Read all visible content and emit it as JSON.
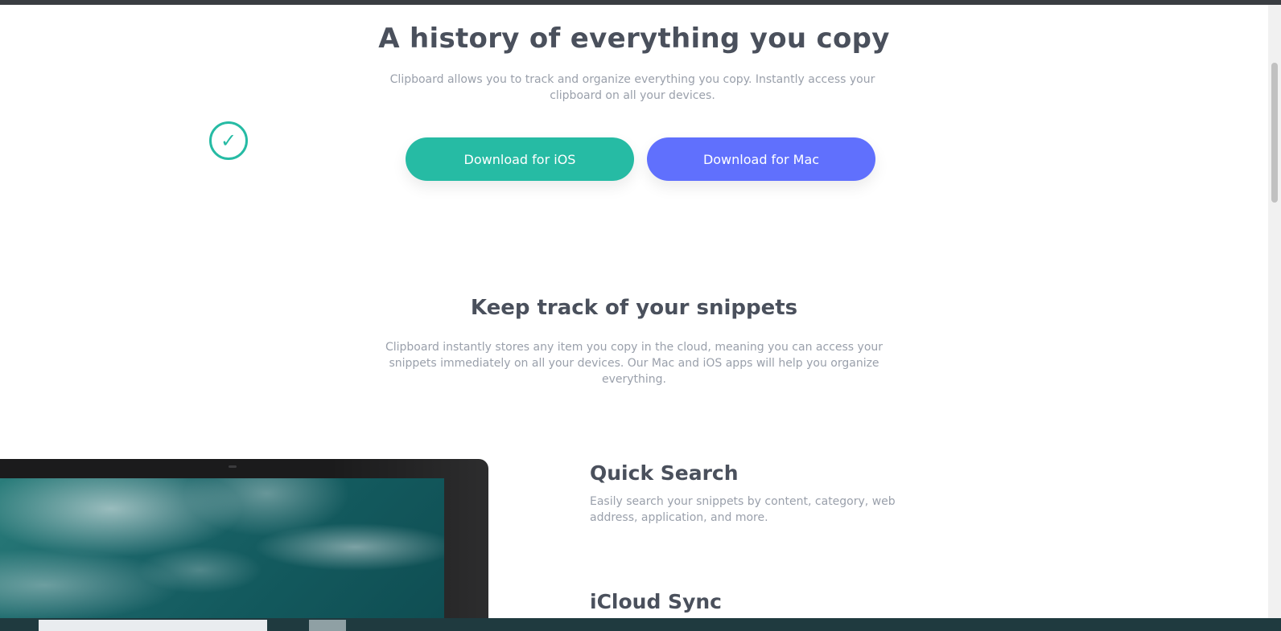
{
  "hero": {
    "title": "A history of everything you copy",
    "subtitle": "Clipboard allows you to track and organize everything you copy. Instantly access your clipboard on all your devices."
  },
  "buttons": {
    "ios_label": "Download for iOS",
    "mac_label": "Download for Mac"
  },
  "snippets": {
    "title": "Keep track of your snippets",
    "subtitle": "Clipboard instantly stores any item you copy in the cloud, meaning you can access your snippets immediately on all your devices. Our Mac and iOS apps will help you organize everything."
  },
  "features": [
    {
      "title": "Quick Search",
      "description": "Easily search your snippets by content, category, web address, application, and more."
    },
    {
      "title": "iCloud Sync",
      "description": ""
    }
  ],
  "icons": {
    "screen_check": "check-icon"
  },
  "colors": {
    "ios_button": "#26bba4",
    "mac_button": "#6070fd",
    "heading": "#4a505c",
    "body_text": "#9aa0ab"
  }
}
